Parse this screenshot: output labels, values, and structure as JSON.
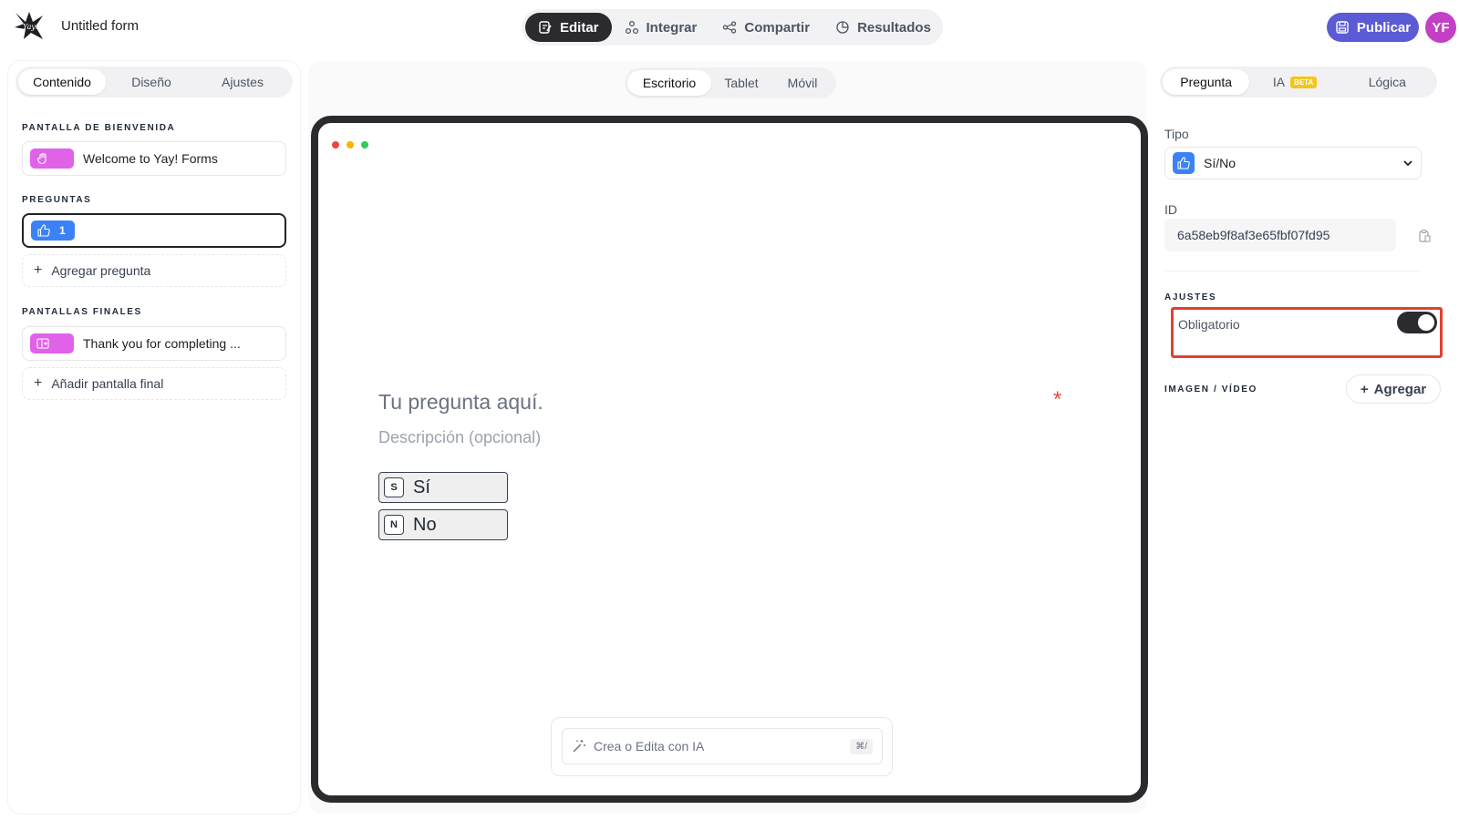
{
  "header": {
    "title": "Untitled form",
    "tabs": [
      {
        "label": "Editar",
        "icon": "edit-icon",
        "active": true
      },
      {
        "label": "Integrar",
        "icon": "integrate-icon",
        "active": false
      },
      {
        "label": "Compartir",
        "icon": "share-icon",
        "active": false
      },
      {
        "label": "Resultados",
        "icon": "results-icon",
        "active": false
      }
    ],
    "publish_label": "Publicar",
    "avatar_initials": "YF"
  },
  "left": {
    "tabs": [
      "Contenido",
      "Diseño",
      "Ajustes"
    ],
    "active_tab": "Contenido",
    "welcome_label": "PANTALLA DE BIENVENIDA",
    "welcome_card": "Welcome to Yay! Forms",
    "questions_label": "PREGUNTAS",
    "question_number": "1",
    "add_question": "Agregar pregunta",
    "final_label": "PANTALLAS FINALES",
    "final_card": "Thank you for completing ...",
    "add_final": "Añadir pantalla final"
  },
  "center": {
    "device_tabs": [
      "Escritorio",
      "Tablet",
      "Móvil"
    ],
    "active_device": "Escritorio",
    "question_placeholder": "Tu pregunta aquí.",
    "description_placeholder": "Descripción (opcional)",
    "required_mark": "*",
    "choices": [
      {
        "key": "S",
        "label": "Sí"
      },
      {
        "key": "N",
        "label": "No"
      }
    ],
    "ai_placeholder": "Crea o Edita con IA",
    "ai_shortcut": "⌘/"
  },
  "right": {
    "tabs": [
      "Pregunta",
      "IA",
      "Lógica"
    ],
    "ia_badge": "BETA",
    "active_tab": "Pregunta",
    "type_label": "Tipo",
    "type_value": "Sí/No",
    "id_label": "ID",
    "id_value": "6a58eb9f8af3e65fbf07fd95",
    "settings_label": "AJUSTES",
    "required_label": "Obligatorio",
    "required_on": true,
    "media_label": "IMAGEN / VÍDEO",
    "add_media": "Agregar"
  },
  "colors": {
    "accent": "#5b5bd6",
    "avatar": "#c240c4",
    "welcome_pill": "#e062e8",
    "question_pill": "#3b82f6",
    "highlight": "#e0412f",
    "required": "#e24a3b"
  }
}
